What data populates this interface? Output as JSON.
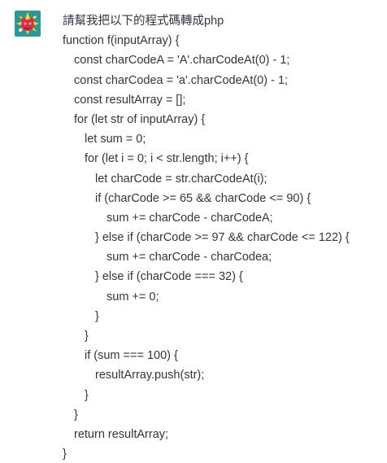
{
  "user_message": {
    "avatar_icon": "user-avatar-icon",
    "prompt": "請幫我把以下的程式碼轉成php",
    "code_lines": [
      {
        "indent": 0,
        "text": "function f(inputArray) {"
      },
      {
        "indent": 1,
        "text": "const charCodeA = 'A'.charCodeAt(0) - 1;"
      },
      {
        "indent": 1,
        "text": "const charCodea = 'a'.charCodeAt(0) - 1;"
      },
      {
        "indent": 1,
        "text": "const resultArray = [];"
      },
      {
        "indent": 1,
        "text": "for (let str of inputArray) {"
      },
      {
        "indent": 2,
        "text": "let sum = 0;"
      },
      {
        "indent": 2,
        "text": "for (let i = 0; i < str.length; i++) {"
      },
      {
        "indent": 3,
        "text": "let charCode = str.charCodeAt(i);"
      },
      {
        "indent": 3,
        "text": "if (charCode >= 65 && charCode <= 90) {"
      },
      {
        "indent": 4,
        "text": "sum += charCode - charCodeA;"
      },
      {
        "indent": 3,
        "text": "} else if (charCode >= 97 && charCode <= 122) {"
      },
      {
        "indent": 4,
        "text": "sum += charCode - charCodea;"
      },
      {
        "indent": 3,
        "text": "} else if (charCode === 32) {"
      },
      {
        "indent": 4,
        "text": "sum += 0;"
      },
      {
        "indent": 3,
        "text": "}"
      },
      {
        "indent": 2,
        "text": "}"
      },
      {
        "indent": 2,
        "text": "if (sum === 100) {"
      },
      {
        "indent": 3,
        "text": "resultArray.push(str);"
      },
      {
        "indent": 2,
        "text": "}"
      },
      {
        "indent": 1,
        "text": "}"
      },
      {
        "indent": 1,
        "text": "return resultArray;"
      },
      {
        "indent": 0,
        "text": "}"
      }
    ]
  },
  "colors": {
    "text": "#343541",
    "background": "#ffffff",
    "avatar_bg": "#2a8f8a",
    "avatar_accent": "#d9304a"
  }
}
